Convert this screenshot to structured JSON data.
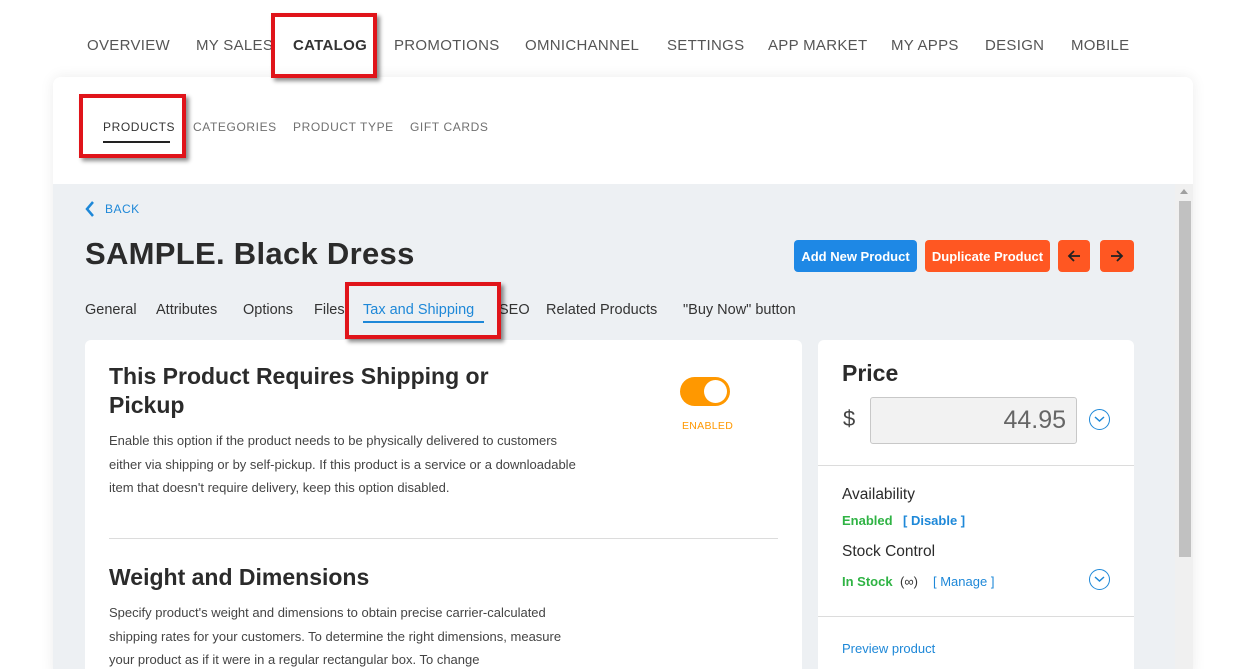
{
  "topnav": {
    "items": [
      "OVERVIEW",
      "MY SALES",
      "CATALOG",
      "PROMOTIONS",
      "OMNICHANNEL",
      "SETTINGS",
      "APP MARKET",
      "MY APPS",
      "DESIGN",
      "MOBILE"
    ],
    "active": "CATALOG"
  },
  "subnav": {
    "items": [
      "PRODUCTS",
      "CATEGORIES",
      "PRODUCT TYPE",
      "GIFT CARDS"
    ],
    "active": "PRODUCTS"
  },
  "back_label": "BACK",
  "product_title": "SAMPLE. Black Dress",
  "actions": {
    "add_new": "Add New Product",
    "duplicate": "Duplicate Product"
  },
  "tabs": {
    "items": [
      "General",
      "Attributes",
      "Options",
      "Files",
      "Tax and Shipping",
      "SEO",
      "Related Products",
      "\"Buy Now\" button"
    ],
    "active": "Tax and Shipping"
  },
  "shipping": {
    "title": "This Product Requires Shipping or Pickup",
    "description": "Enable this option if the product needs to be physically delivered to customers either via shipping or by self-pickup. If this product is a service or a downloadable item that doesn't require delivery, keep this option disabled.",
    "toggle_state": "ENABLED"
  },
  "weight": {
    "title": "Weight and Dimensions",
    "description": "Specify product's weight and dimensions to obtain precise carrier-calculated shipping rates for your customers. To determine the right dimensions, measure your product as if it were in a regular rectangular box. To change"
  },
  "price": {
    "title": "Price",
    "currency": "$",
    "value": "44.95"
  },
  "availability": {
    "label": "Availability",
    "status": "Enabled",
    "action": "[ Disable ]"
  },
  "stock": {
    "label": "Stock Control",
    "status": "In Stock",
    "quantity": "(∞)",
    "action": "[ Manage ]"
  },
  "preview_link": "Preview product",
  "colors": {
    "accent_blue": "#1e88e5",
    "accent_orange": "#ff5722",
    "toggle_orange": "#ff9800",
    "green": "#2fb344",
    "highlight_red": "#e0141a"
  }
}
